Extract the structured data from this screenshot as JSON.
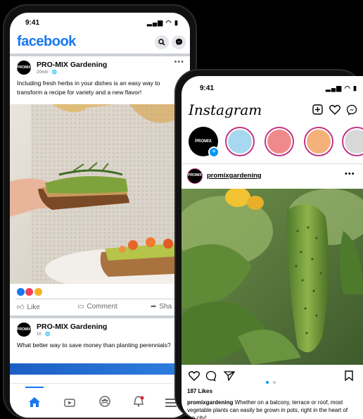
{
  "facebook": {
    "status_time": "9:41",
    "status_icons": "▂▄▆ ◠ ▮",
    "logo": "facebook",
    "search_icon": "search-icon",
    "messenger_icon": "messenger-icon",
    "post1": {
      "author": "PRO-MIX Gardening",
      "meta": "20min · 🌐",
      "avatar_text": "PROMIX",
      "text": "Including fresh herbs in your dishes is an easy way to transform a recipe for variety and a new flavor!",
      "reactions": [
        "like-reaction-icon",
        "love-reaction-icon",
        "wow-reaction-icon"
      ]
    },
    "actions": {
      "like": "Like",
      "comment": "Comment",
      "share": "Sha"
    },
    "post2": {
      "author": "PRO-MIX Gardening",
      "meta": "1h · 🌐",
      "avatar_text": "PROMIX",
      "text": "What better way to save money than planting perennials?"
    },
    "nav": [
      "home-icon",
      "video-icon",
      "groups-icon",
      "notifications-icon",
      "menu-icon"
    ]
  },
  "instagram": {
    "status_time": "9:41",
    "status_icons": "▂▄▆ ◠ ▮",
    "logo": "Instagram",
    "own_story_avatar": "PROMIX",
    "story_colors": [
      "#a8d8f0",
      "#f08a8a",
      "#f4b27a",
      "#d8d8d8"
    ],
    "post": {
      "avatar_text": "PROMIX",
      "username": "promixgardening",
      "likes": "187 Likes",
      "caption_user": "promixgardening",
      "caption_text": " Whether on a balcony, terrace or roof, most vegetable plants can easily be grown in pots, right in the heart of the city!",
      "carousel_pages": 2,
      "carousel_current": 1
    }
  },
  "colors": {
    "facebook_blue": "#1877f2",
    "ig_gradient": "#c13584"
  }
}
